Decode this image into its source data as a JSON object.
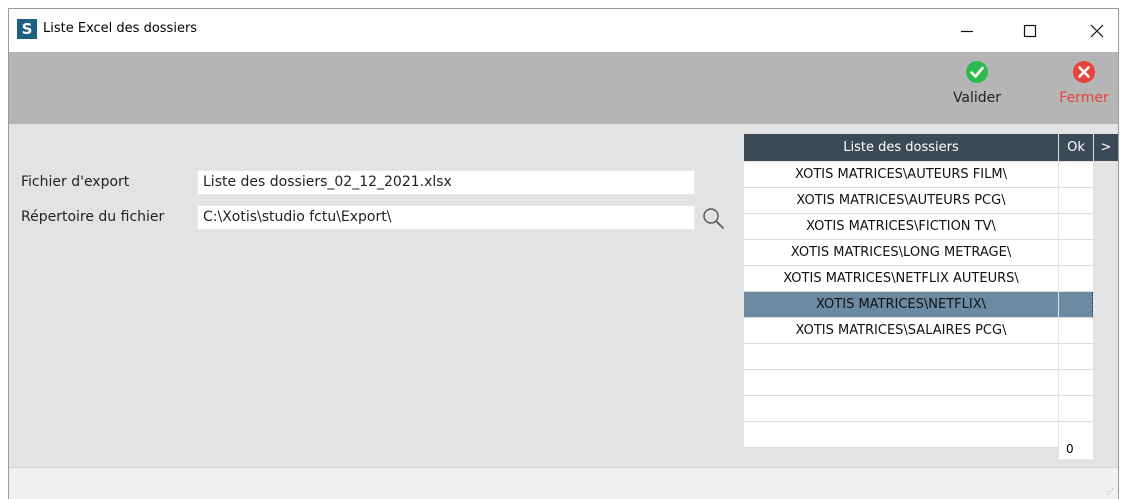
{
  "window": {
    "app_icon_letter": "S",
    "title": "Liste Excel des dossiers",
    "controls": {
      "minimize": "minimize",
      "maximize": "maximize",
      "close": "close"
    }
  },
  "toolbar": {
    "validate_label": "Valider",
    "close_label": "Fermer",
    "validate_color": "#2dbb4e",
    "close_color": "#e8423d"
  },
  "form": {
    "export_file_label": "Fichier d'export",
    "export_file_value": "Liste des dossiers_02_12_2021.xlsx",
    "directory_label": "Répertoire du fichier",
    "directory_value": "C:\\Xotis\\studio fctu\\Export\\"
  },
  "grid": {
    "header_name": "Liste des dossiers",
    "header_ok": "Ok",
    "header_more": ">",
    "rows": [
      {
        "name": "XOTIS MATRICES\\AUTEURS FILM\\",
        "ok": ""
      },
      {
        "name": "XOTIS MATRICES\\AUTEURS PCG\\",
        "ok": ""
      },
      {
        "name": "XOTIS MATRICES\\FICTION TV\\",
        "ok": ""
      },
      {
        "name": "XOTIS MATRICES\\LONG METRAGE\\",
        "ok": ""
      },
      {
        "name": "XOTIS MATRICES\\NETFLIX AUTEURS\\",
        "ok": ""
      },
      {
        "name": "XOTIS MATRICES\\NETFLIX\\",
        "ok": ""
      },
      {
        "name": "XOTIS MATRICES\\SALAIRES PCG\\",
        "ok": ""
      },
      {
        "name": "",
        "ok": ""
      },
      {
        "name": "",
        "ok": ""
      },
      {
        "name": "",
        "ok": ""
      },
      {
        "name": "",
        "ok": ""
      }
    ],
    "selected_index": 5,
    "ok_count": "0"
  }
}
